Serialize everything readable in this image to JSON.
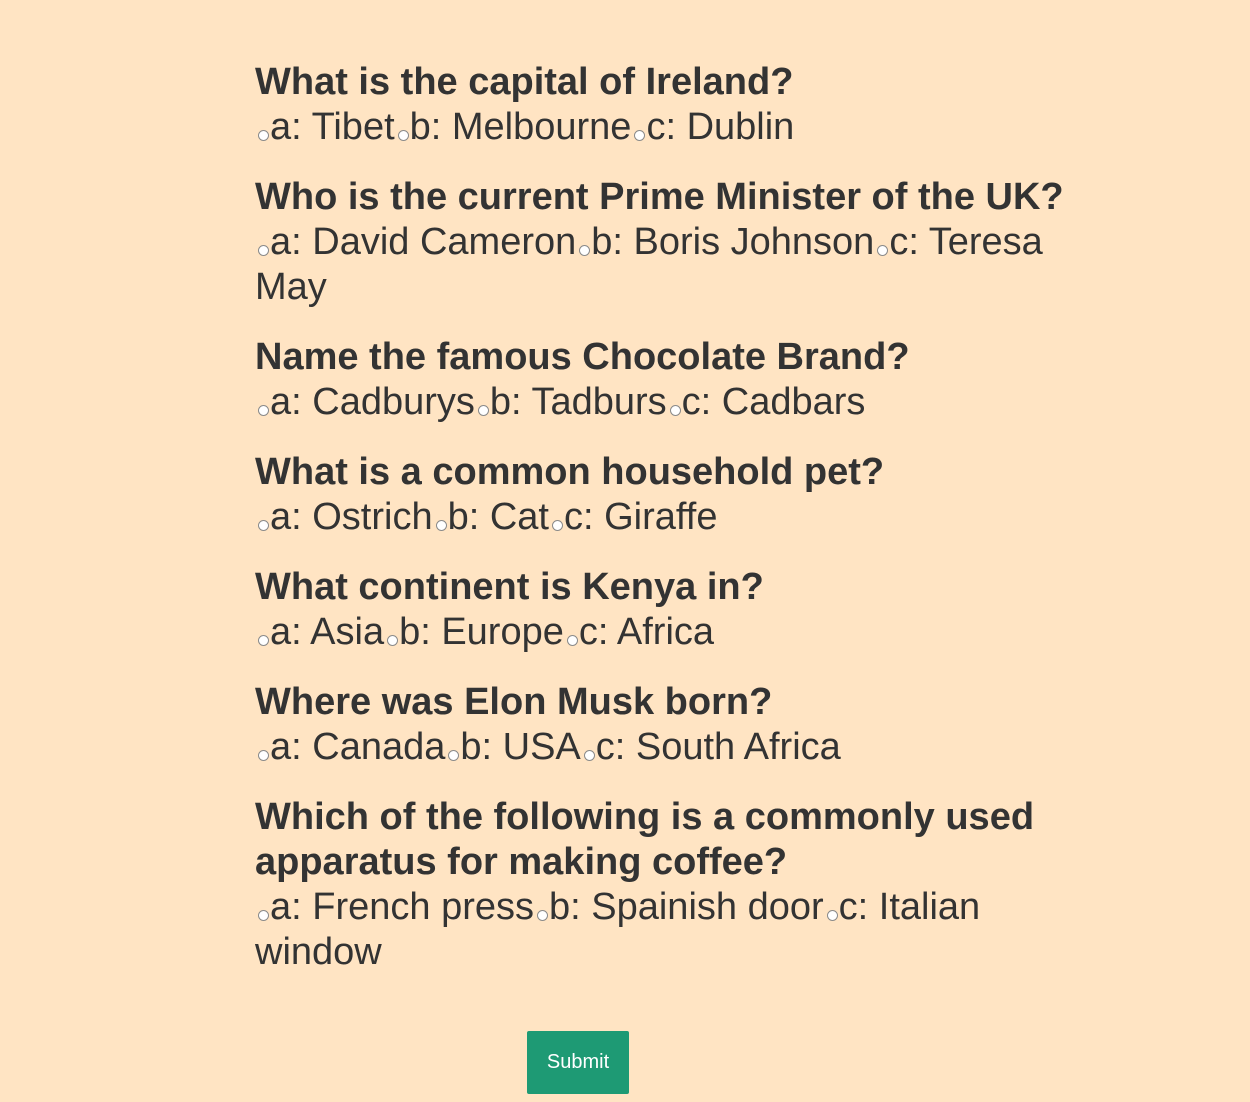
{
  "questions": [
    {
      "text": "What is the capital of Ireland?",
      "options": [
        "a: Tibet",
        "b: Melbourne",
        "c: Dublin"
      ]
    },
    {
      "text": "Who is the current Prime Minister of the UK?",
      "options": [
        "a: David Cameron",
        "b: Boris Johnson",
        "c: Teresa May"
      ]
    },
    {
      "text": "Name the famous Chocolate Brand?",
      "options": [
        "a: Cadburys",
        "b: Tadburs",
        "c: Cadbars"
      ]
    },
    {
      "text": "What is a common household pet?",
      "options": [
        "a: Ostrich",
        "b: Cat",
        "c: Giraffe"
      ]
    },
    {
      "text": "What continent is Kenya in?",
      "options": [
        "a: Asia",
        "b: Europe",
        "c: Africa"
      ]
    },
    {
      "text": "Where was Elon Musk born?",
      "options": [
        "a: Canada",
        "b: USA",
        "c: South Africa"
      ]
    },
    {
      "text": "Which of the following is a commonly used apparatus for making coffee?",
      "options": [
        "a: French press",
        "b: Spainish door",
        "c: Italian window"
      ]
    }
  ],
  "submit_label": "Submit",
  "colors": {
    "background": "#ffe4c3",
    "text": "#333333",
    "button": "#1e9a74"
  }
}
